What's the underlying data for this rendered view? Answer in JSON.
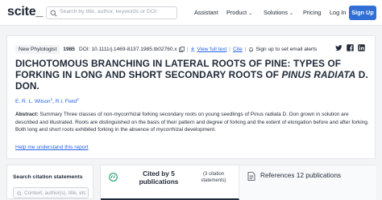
{
  "header": {
    "logo": "scite_",
    "search_placeholder": "Search by title, author, keywords or DOI",
    "nav": {
      "assistant": "Assistant",
      "product": "Product",
      "solutions": "Solutions",
      "pricing": "Pricing",
      "login": "Log In",
      "signup": "Sign Up"
    }
  },
  "paper": {
    "journal": "New Phytologist",
    "year": "1985",
    "doi": "DOI: 10.1111/j.1469-8137.1985.tb02760.x",
    "view_full_text": "View full text",
    "cite": "Cite",
    "alerts": "Sign up to set email alerts",
    "title_main": "DICHOTOMOUS BRANCHING IN LATERAL ROOTS OF PINE: TYPES OF FORKING IN LONG AND SHORT SECONDARY ROOTS OF ",
    "title_species": "PINUS RADIATA",
    "title_end": " D. DON.",
    "author1": "E. R. L. Wilson",
    "author1_sup": "1",
    "author_sep": ", ",
    "author2": "R.I. Field",
    "author2_sup": "2",
    "abstract_label": "Abstract:",
    "abstract_text": " Summary Three classes of non‐mycorrhizal forking secondary roots on young seedlings of Pinus radiata D. Don grown in solution are described and illustrated. Roots are distinguished on the basis of their pattern and degree of forking and the extent of elongation before and after forking. Both long and short roots exhibited forking in the absence of mycorrhizal development.",
    "help_link": "Help me understand this report"
  },
  "sidebar": {
    "title": "Search citation statements",
    "input_placeholder": "Context, author(s), title, etc"
  },
  "tabs": {
    "cited_by": "Cited by 5 publications",
    "citation_statements": "(3 citation statements)",
    "references": "References 12 publications"
  },
  "colors": {
    "accent": "#2f6fd6",
    "link": "#2563eb",
    "cite_icon": "#22a06b"
  }
}
